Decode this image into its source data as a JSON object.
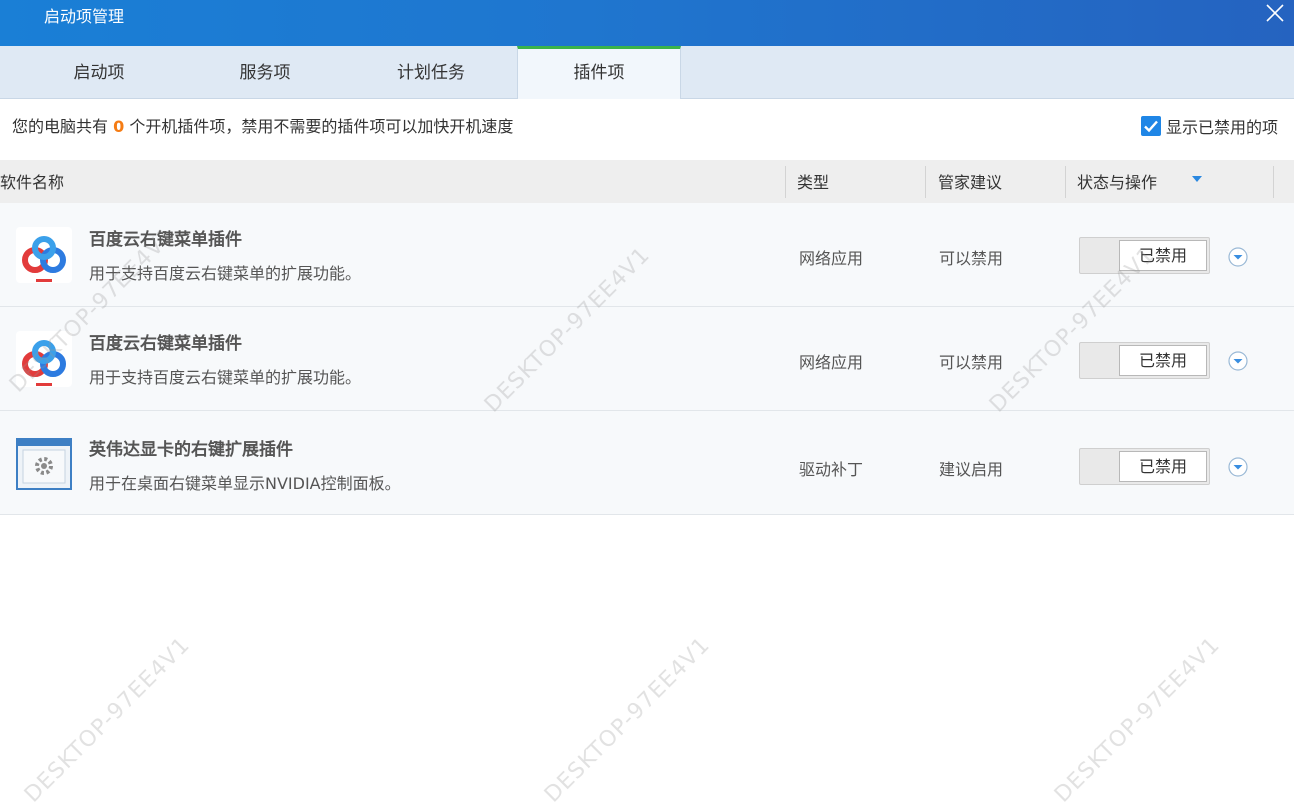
{
  "window": {
    "title": "启动项管理"
  },
  "tabs": [
    {
      "label": "启动项"
    },
    {
      "label": "服务项"
    },
    {
      "label": "计划任务"
    },
    {
      "label": "插件项"
    }
  ],
  "info": {
    "prefix": "您的电脑共有 ",
    "count": "0",
    "suffix": " 个开机插件项，禁用不需要的插件项可以加快开机速度"
  },
  "show_disabled": {
    "label": "显示已禁用的项",
    "checked": true
  },
  "columns": {
    "name": "软件名称",
    "type": "类型",
    "advice": "管家建议",
    "status": "状态与操作"
  },
  "rows": [
    {
      "name": "百度云右键菜单插件",
      "desc": "用于支持百度云右键菜单的扩展功能。",
      "type": "网络应用",
      "advice": "可以禁用",
      "status": "已禁用",
      "icon": "baidu-cloud-icon"
    },
    {
      "name": "百度云右键菜单插件",
      "desc": "用于支持百度云右键菜单的扩展功能。",
      "type": "网络应用",
      "advice": "可以禁用",
      "status": "已禁用",
      "icon": "baidu-cloud-icon"
    },
    {
      "name": "英伟达显卡的右键扩展插件",
      "desc": "用于在桌面右键菜单显示NVIDIA控制面板。",
      "type": "驱动补丁",
      "advice": "建议启用",
      "status": "已禁用",
      "icon": "settings-window-icon"
    }
  ],
  "watermark": "DESKTOP-97EE4V1",
  "colors": {
    "title_bar": "#1a7fd6",
    "accent_tab": "#3bb34a",
    "count": "#f57c14",
    "checkbox": "#1f86e6"
  }
}
